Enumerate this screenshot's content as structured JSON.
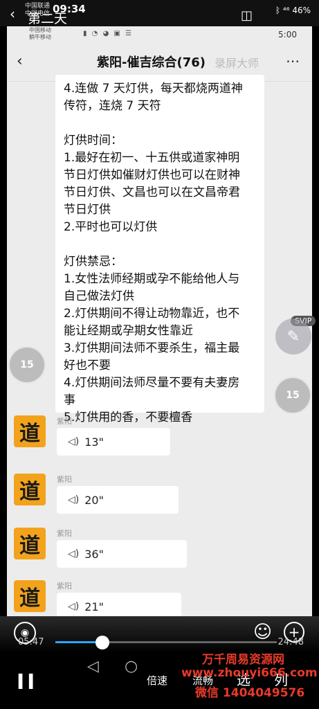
{
  "outer": {
    "carrier_line1": "中国联通",
    "carrier_line2": "中国电信",
    "time": "09:34",
    "title": "第二天",
    "right_status": "ᛒ ⁴⁶ 46%"
  },
  "inner": {
    "carrier_line1": "中国移动",
    "carrier_line2": "躺牛移动",
    "time": "5:00"
  },
  "chat": {
    "title": "紫阳-催吉综合(76)",
    "watermark": "录屏大师",
    "big_text": "4.连做 7 天灯供，每天都烧两道神\n传符，连烧 7 天符\n\n灯供时间：\n1.最好在初一、十五供或道家神明\n节日灯供如催财灯供也可以在财神\n节日灯供、文昌也可以在文昌帝君\n节日灯供\n2.平时也可以灯供\n\n灯供禁忌：\n1.女性法师经期或孕不能给他人与\n自己做法灯供\n2.灯供期间不得让动物靠近，也不\n能让经期或孕期女性靠近\n3.灯供期间法师不要杀生，福主最\n好也不要\n4.灯供期间法师尽量不要有夫妻房\n事\n5.灯供用的香，不要檀香",
    "messages": [
      {
        "avatar": "道",
        "sender": "紫阳",
        "duration": "13\""
      },
      {
        "avatar": "道",
        "sender": "紫阳",
        "duration": "20\""
      },
      {
        "avatar": "道",
        "sender": "紫阳",
        "duration": "36\""
      },
      {
        "avatar": "道",
        "sender": "紫阳",
        "duration": "21\""
      }
    ]
  },
  "controls": {
    "rewind_label": "15",
    "forward_label": "15",
    "svip": "SVIP",
    "current_time": "05:47",
    "total_time": "24:48",
    "progress": 0.2,
    "speed_label": "倍速",
    "flow_label": "流畅",
    "select_label": "选",
    "list_label": "列"
  },
  "ad": {
    "line1": "万千周易资源网",
    "line2": "www.zhouyi666.com",
    "line3": "微信 1404049576"
  },
  "icons": {
    "back": "chevron-left-icon",
    "pause": "pause-icon"
  }
}
